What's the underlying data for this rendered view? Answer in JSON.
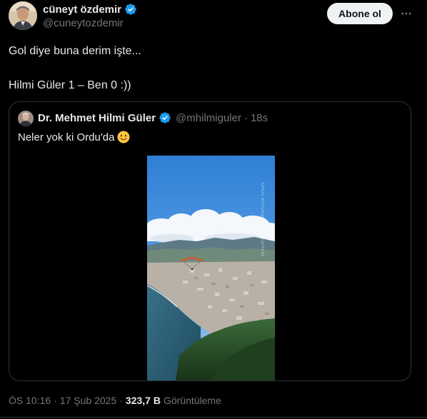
{
  "author": {
    "display_name": "cüneyt özdemir",
    "handle": "@cuneytozdemir",
    "verified_icon": "verified-badge-icon",
    "avatar_icon": "profile-photo"
  },
  "actions": {
    "follow_label": "Abone ol",
    "more_icon": "more-horizontal-icon"
  },
  "tweet": {
    "line1": "Gol diye buna derim işte...",
    "line2": "Hilmi Güler 1 –  Ben 0 :))"
  },
  "quoted": {
    "display_name": "Dr. Mehmet Hilmi Güler",
    "handle": "@mhilmiguler",
    "separator": "·",
    "time": "18s",
    "text": "Neler yok ki Ordu'da",
    "emoji": "smiling-face-emoji",
    "media_watermark": "ORDU BÜYÜKŞEHİR BELEDİYESİ"
  },
  "meta": {
    "time": "ÖS 10:16",
    "separator1": "·",
    "date": "17 Şub 2025",
    "separator2": "·",
    "views_count": "323,7 B",
    "views_label": "Görüntüleme"
  },
  "colors": {
    "background": "#000000",
    "text_primary": "#e7e9ea",
    "text_secondary": "#71767b",
    "verified_blue": "#1d9bf0",
    "border": "#2f3336",
    "button_bg": "#eff3f4"
  }
}
